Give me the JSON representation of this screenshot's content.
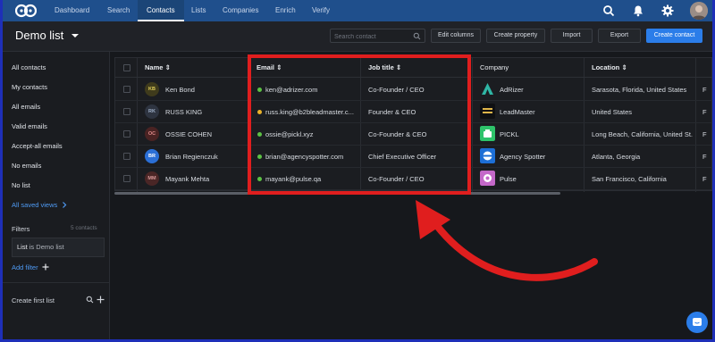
{
  "nav": {
    "items": [
      {
        "label": "Dashboard",
        "active": false
      },
      {
        "label": "Search",
        "active": false
      },
      {
        "label": "Contacts",
        "active": true
      },
      {
        "label": "Lists",
        "active": false
      },
      {
        "label": "Companies",
        "active": false
      },
      {
        "label": "Enrich",
        "active": false
      },
      {
        "label": "Verify",
        "active": false
      }
    ],
    "icons": [
      "search-icon",
      "bell-icon",
      "gear-icon",
      "user-avatar"
    ]
  },
  "header": {
    "title": "Demo list",
    "search_placeholder": "Search contact",
    "buttons": {
      "edit_columns": "Edit columns",
      "create_property": "Create property",
      "import": "Import",
      "export": "Export",
      "create_contact": "Create contact"
    }
  },
  "sidebar": {
    "items": [
      {
        "label": "All contacts"
      },
      {
        "label": "My contacts"
      },
      {
        "label": "All emails"
      },
      {
        "label": "Valid emails"
      },
      {
        "label": "Accept-all emails"
      },
      {
        "label": "No emails"
      },
      {
        "label": "No list"
      },
      {
        "label": "All saved views"
      }
    ],
    "filters": {
      "label": "Filters",
      "count": "5 contacts",
      "chip_key": "List",
      "chip_op": "is",
      "chip_value": "Demo list",
      "add_filter": "Add filter"
    },
    "create_first_list": "Create first list"
  },
  "table": {
    "columns": {
      "name": "Name",
      "email": "Email",
      "job_title": "Job title",
      "company": "Company",
      "location": "Location"
    },
    "rows": [
      {
        "initials": "KB",
        "name": "Ken Bond",
        "email": "ken@adrizer.com",
        "email_status": "valid",
        "job_title": "Co-Founder / CEO",
        "company": "AdRizer",
        "location": "Sarasota, Florida, United States",
        "extra": "F"
      },
      {
        "initials": "RK",
        "name": "RUSS KING",
        "email": "russ.king@b2bleadmaster.c...",
        "email_status": "accept-all",
        "job_title": "Founder & CEO",
        "company": "LeadMaster",
        "location": "United States",
        "extra": "F"
      },
      {
        "initials": "OC",
        "name": "OSSIE COHEN",
        "email": "ossie@pickl.xyz",
        "email_status": "valid",
        "job_title": "Co-Founder & CEO",
        "company": "PICKL",
        "location": "Long Beach, California, United St...",
        "extra": "F"
      },
      {
        "initials": "BR",
        "name": "Brian Regienczuk",
        "email": "brian@agencyspotter.com",
        "email_status": "valid",
        "job_title": "Chief Executive Officer",
        "company": "Agency Spotter",
        "location": "Atlanta, Georgia",
        "extra": "F"
      },
      {
        "initials": "MM",
        "name": "Mayank Mehta",
        "email": "mayank@pulse.qa",
        "email_status": "valid",
        "job_title": "Co-Founder / CEO",
        "company": "Pulse",
        "location": "San Francisco, California",
        "extra": "F"
      }
    ]
  },
  "colors": {
    "nav_bg": "#1f4f8c",
    "accent_blue": "#2b7de9",
    "valid_dot": "#5cc244",
    "accept_all_dot": "#e9b22a",
    "highlight_red": "#e01e1e",
    "border_frame": "#1e2fb8"
  }
}
